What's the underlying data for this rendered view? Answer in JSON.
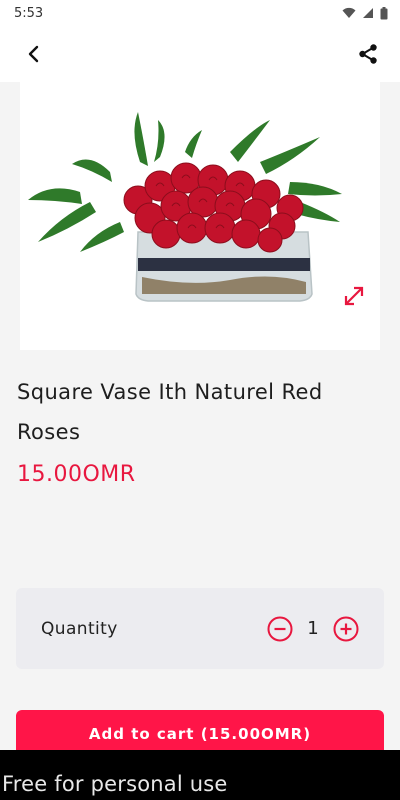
{
  "status_bar": {
    "time": "5:53",
    "icons": [
      "wifi-icon",
      "signal-icon",
      "battery-icon"
    ]
  },
  "app_bar": {
    "back_icon": "back-arrow-icon",
    "share_icon": "share-icon"
  },
  "product": {
    "image_alt": "Square vase with naturel red roses",
    "title": "Square Vase Ith Naturel Red Roses",
    "price": "15.00OMR",
    "expand_icon": "expand-icon"
  },
  "quantity": {
    "label": "Quantity",
    "value": "1",
    "minus_icon": "minus-circle-icon",
    "plus_icon": "plus-circle-icon"
  },
  "cart": {
    "button_label": "Add to cart (15.00OMR)"
  },
  "watermark": {
    "text": "Free for personal use"
  },
  "colors": {
    "accent": "#e8173f",
    "button": "#ff1548",
    "card": "#ececf0",
    "background": "#f4f4f4"
  }
}
